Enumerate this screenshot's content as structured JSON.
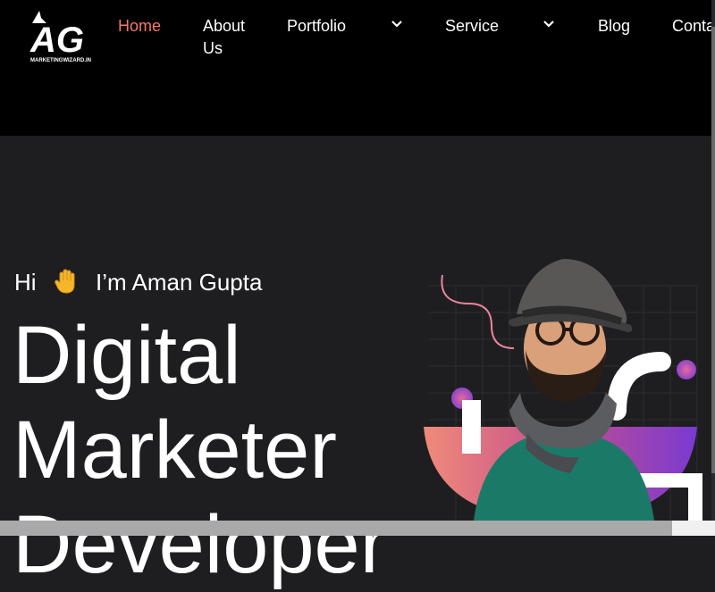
{
  "brand": {
    "logo_text": "AG",
    "logo_subtext": "MARKETINGWIZARD.IN",
    "accent": "#f47a66"
  },
  "nav": {
    "items": [
      {
        "label": "Home",
        "active": true
      },
      {
        "label": "About",
        "label2": "Us"
      },
      {
        "label": "Portfolio",
        "dropdown": true
      },
      {
        "label": "Service",
        "dropdown": true
      },
      {
        "label": "Blog"
      },
      {
        "label": "Conta"
      }
    ]
  },
  "hero": {
    "greeting_hi": "Hi",
    "greeting_name": "I’m Aman Gupta",
    "headline": [
      "Digital",
      "Marketer",
      "Developer"
    ]
  },
  "icons": {
    "logo": "wizard-hat-logo",
    "hand": "raised-hand-icon",
    "dropdown": "chevron-down-icon"
  }
}
